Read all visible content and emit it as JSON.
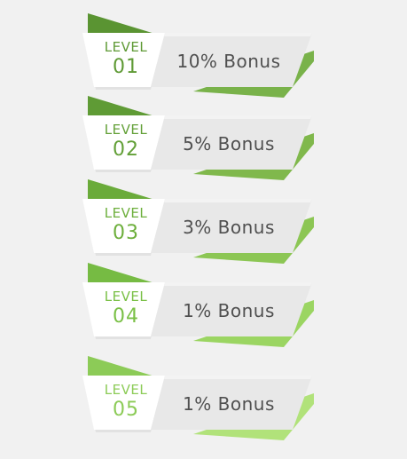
{
  "levels": [
    {
      "label": "LEVEL",
      "number": "01",
      "bonus": "10% Bonus",
      "accent": "#5a9432",
      "accent_light": "#79b24a",
      "text_color": "#5f9a35"
    },
    {
      "label": "LEVEL",
      "number": "02",
      "bonus": "5% Bonus",
      "accent": "#5f9b35",
      "accent_light": "#80b84c",
      "text_color": "#63a038"
    },
    {
      "label": "LEVEL",
      "number": "03",
      "bonus": "3% Bonus",
      "accent": "#6aab3a",
      "accent_light": "#8cc654",
      "text_color": "#6daf3c"
    },
    {
      "label": "LEVEL",
      "number": "04",
      "bonus": "1% Bonus",
      "accent": "#76bb43",
      "accent_light": "#9bd562",
      "text_color": "#7ac046"
    },
    {
      "label": "LEVEL",
      "number": "05",
      "bonus": "1% Bonus",
      "accent": "#8ccb57",
      "accent_light": "#b1e27a",
      "text_color": "#8ccb57"
    }
  ]
}
